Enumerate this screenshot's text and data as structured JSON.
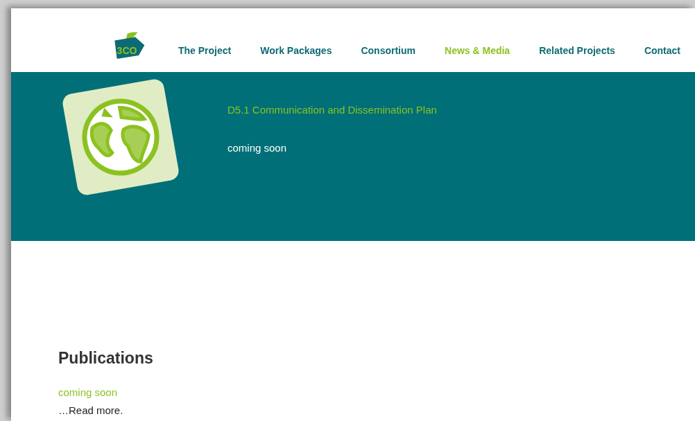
{
  "logo": {
    "text": "3CO"
  },
  "nav": [
    {
      "label": "The Project",
      "selected": false
    },
    {
      "label": "Work Packages",
      "selected": false
    },
    {
      "label": "Consortium",
      "selected": false
    },
    {
      "label": "News & Media",
      "selected": true
    },
    {
      "label": "Related Projects",
      "selected": false
    },
    {
      "label": "Contact",
      "selected": false
    }
  ],
  "hero": {
    "title": "D5.1 Communication and Dissemination Plan",
    "text": "coming soon"
  },
  "publications": {
    "heading": "Publications",
    "items": [
      {
        "title": "coming soon",
        "link": "…Read more."
      }
    ]
  }
}
